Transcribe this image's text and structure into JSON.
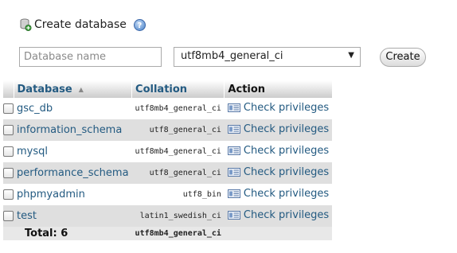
{
  "create": {
    "title": "Create database",
    "help_icon": "question-circle-icon",
    "db_icon": "database-add-icon"
  },
  "form": {
    "name_placeholder": "Database name",
    "name_value": "",
    "collation_selected": "utf8mb4_general_ci",
    "create_label": "Create"
  },
  "table": {
    "headers": {
      "database": "Database",
      "collation": "Collation",
      "action": "Action"
    },
    "rows": [
      {
        "name": "gsc_db",
        "collation": "utf8mb4_general_ci",
        "action": "Check privileges"
      },
      {
        "name": "information_schema",
        "collation": "utf8_general_ci",
        "action": "Check privileges"
      },
      {
        "name": "mysql",
        "collation": "utf8mb4_general_ci",
        "action": "Check privileges"
      },
      {
        "name": "performance_schema",
        "collation": "utf8_general_ci",
        "action": "Check privileges"
      },
      {
        "name": "phpmyadmin",
        "collation": "utf8_bin",
        "action": "Check privileges"
      },
      {
        "name": "test",
        "collation": "latin1_swedish_ci",
        "action": "Check privileges"
      }
    ],
    "footer": {
      "total": "Total: 6",
      "collation": "utf8mb4_general_ci"
    }
  },
  "colors": {
    "link": "#235a81",
    "row_alt": "#dfdfdf"
  }
}
